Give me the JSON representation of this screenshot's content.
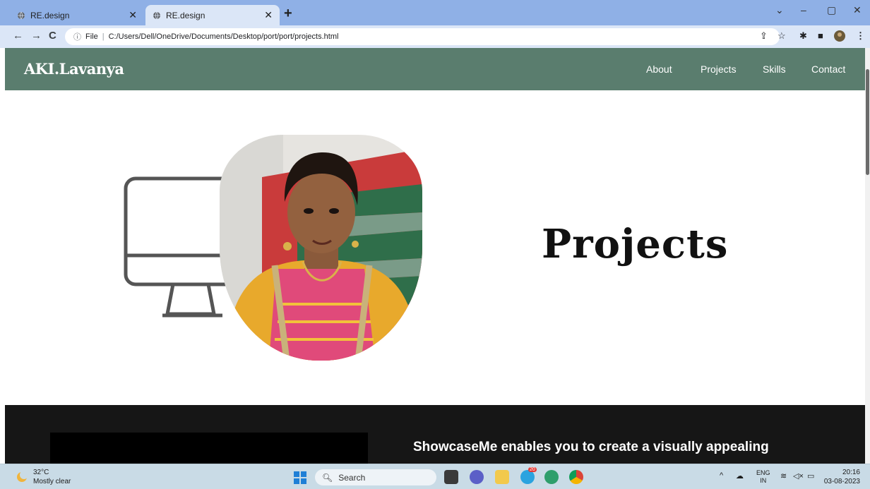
{
  "browser": {
    "tabs": [
      {
        "title": "RE.design",
        "active": false
      },
      {
        "title": "RE.design",
        "active": true
      }
    ],
    "new_tab_label": "+",
    "window_controls": {
      "minimize": "–",
      "restore": "▢",
      "close": "✕",
      "tablist": "⌄"
    },
    "nav": {
      "back": "←",
      "forward": "→",
      "reload": "C"
    },
    "address": {
      "info_icon": "info-icon",
      "scheme_label": "File",
      "separator": "|",
      "url": "C:/Users/Dell/OneDrive/Documents/Desktop/port/port/projects.html"
    },
    "toolbar_icons": [
      "share-icon",
      "star-icon",
      "extensions-icon",
      "sidepanel-icon",
      "profile-icon",
      "menu-icon"
    ]
  },
  "site": {
    "logo": "AKI.Lavanya",
    "nav": [
      "About",
      "Projects",
      "Skills",
      "Contact"
    ],
    "header_color": "#5a7d6e"
  },
  "hero": {
    "title": "Projects",
    "monitor_icon": "monitor-icon",
    "photo": "profile-photo"
  },
  "projects_section": {
    "description": "ShowcaseMe enables you to create a visually appealing"
  },
  "taskbar": {
    "weather": {
      "temp": "32°C",
      "condition": "Mostly clear"
    },
    "search_label": "Search",
    "language": {
      "line1": "ENG",
      "line2": "IN"
    },
    "clock": {
      "time": "20:16",
      "date": "03-08-2023"
    },
    "telegram_badge": "20"
  }
}
